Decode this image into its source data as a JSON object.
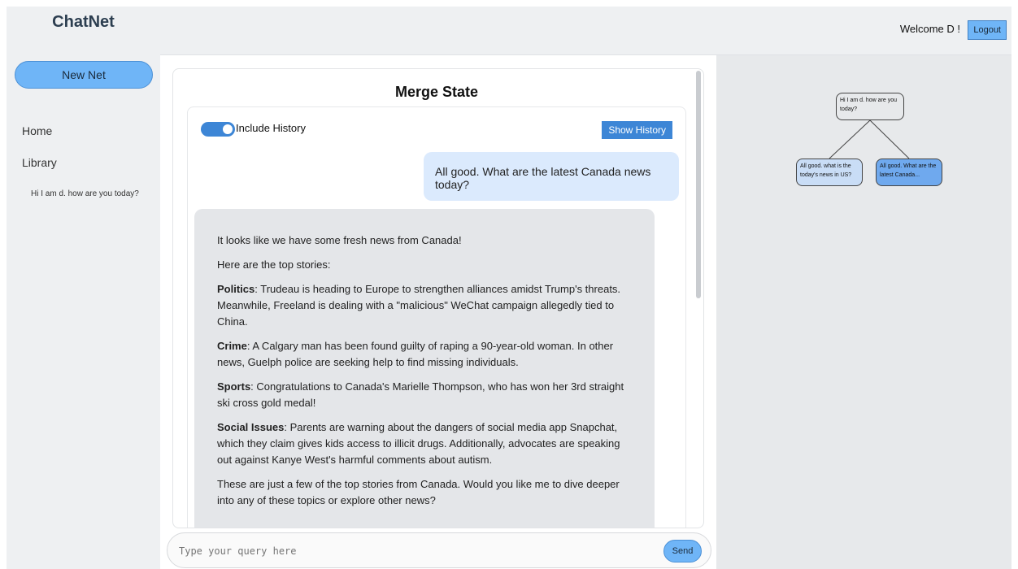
{
  "sidebar": {
    "brand": "ChatNet",
    "new_net_label": "New Net",
    "nav": [
      "Home",
      "Library"
    ],
    "history": [
      "Hi I am d. how are you today?"
    ]
  },
  "header": {
    "welcome": "Welcome D !",
    "logout_label": "Logout"
  },
  "main": {
    "title": "Merge State",
    "include_history_label": "Include History",
    "include_history_on": true,
    "show_history_label": "Show History",
    "user_message": "All good. What are the latest Canada news today?",
    "bot_message": {
      "intro": "It looks like we have some fresh news from Canada!",
      "lead": "Here are the top stories:",
      "items": [
        {
          "label": "Politics",
          "text": ": Trudeau is heading to Europe to strengthen alliances amidst Trump's threats. Meanwhile, Freeland is dealing with a \"malicious\" WeChat campaign allegedly tied to China."
        },
        {
          "label": "Crime",
          "text": ": A Calgary man has been found guilty of raping a 90-year-old woman. In other news, Guelph police are seeking help to find missing individuals."
        },
        {
          "label": "Sports",
          "text": ": Congratulations to Canada's Marielle Thompson, who has won her 3rd straight ski cross gold medal!"
        },
        {
          "label": "Social Issues",
          "text": ": Parents are warning about the dangers of social media app Snapchat, which they claim gives kids access to illicit drugs. Additionally, advocates are speaking out against Kanye West's harmful comments about autism."
        }
      ],
      "outro": "These are just a few of the top stories from Canada. Would you like me to dive deeper into any of these topics or explore other news?"
    },
    "query_placeholder": "Type your query here",
    "send_label": "Send"
  },
  "tree": {
    "root": "Hi I am d. how are you today?",
    "left": "All good. what is the today's news in US?",
    "right": "All good. What are the latest Canada..."
  },
  "colors": {
    "accent": "#6fb5f7",
    "primary": "#3d86d6",
    "user_bubble": "#dbeafd",
    "bot_bubble": "#e4e6e9",
    "selected_node": "#6fa9ee"
  }
}
